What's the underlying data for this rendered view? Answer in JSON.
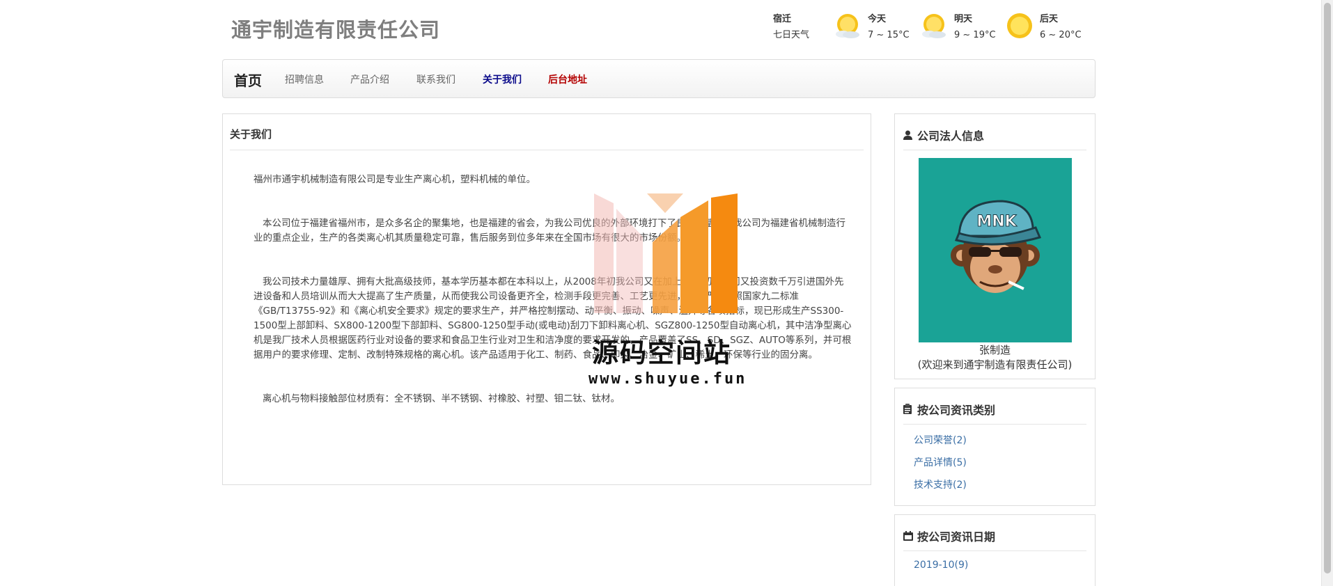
{
  "header": {
    "site_title": "通宇制造有限责任公司",
    "weather": {
      "city": "宿迁",
      "subtitle": "七日天气",
      "days": [
        {
          "name": "今天",
          "temp": "7 ~ 15°C",
          "icon": "sun-cloud-icon"
        },
        {
          "name": "明天",
          "temp": "9 ~ 19°C",
          "icon": "sun-cloud-icon"
        },
        {
          "name": "后天",
          "temp": "6 ~ 20°C",
          "icon": "sun-icon"
        }
      ]
    }
  },
  "nav": {
    "brand": "首页",
    "items": [
      "招聘信息",
      "产品介绍",
      "联系我们",
      "关于我们",
      "后台地址"
    ],
    "active_color": "#0a0a8a",
    "admin_color": "#b30000"
  },
  "main": {
    "title": "关于我们",
    "paragraphs": [
      "福州市通宇机械制造有限公司是专业生产离心机，塑料机械的单位。",
      "本公司位于福建省福州市，是众多名企的聚集地，也是福建的省会，为我公司优良的外部环境打下了良好的基础。我公司为福建省机械制造行业的重点企业，生产的各类离心机其质量稳定可靠，售后服务到位多年来在全国市场有很大的市场份额。",
      "我公司技术力量雄厚、拥有大批高级技师，基本学历基本都在本科以上，从2008年初我公司又在加上09年初我公司又投资数千万引进国外先进设备和人员培训从而大大提高了生产质量，从而使我公司设备更齐全，检测手段更完善、工艺更先进，产品严格按照国家九二标准《GB/T13755-92》和《离心机安全要求》规定的要求生产，并严格控制摆动、动平衡、振动、噪声、温升等各项指标，现已形成生产SS300-1500型上部卸料、SX800-1200型下部卸料、SG800-1250型手动(或电动)刮刀下卸料离心机、SGZ800-1250型自动离心机，其中洁净型离心机是我厂技术人员根据医药行业对设备的要求和食品卫生行业对卫生和洁净度的要求开发的，产品覆盖了SS、SD、SGZ、AUTO等系列，并可根据用户的要求修理、定制、改制特殊规格的离心机。该产品适用于化工、制药、食品、印染、冶金、矿山、稀土、环保等行业的固分离。",
      "离心机与物料接触部位材质有：全不锈钢、半不锈钢、衬橡胶、衬塑、钼二钛、钛材。"
    ]
  },
  "sidebar": {
    "legal": {
      "title": "公司法人信息",
      "icon": "user-icon",
      "avatar_bg": "#1aa396",
      "cap_text": "MNK",
      "name": "张制造",
      "welcome": "(欢迎来到通宇制造有限责任公司)"
    },
    "categories": {
      "title": "按公司资讯类别",
      "icon": "clipboard-icon",
      "items": [
        "公司荣誉(2)",
        "产品详情(5)",
        "技术支持(2)"
      ]
    },
    "dates": {
      "title": "按公司资讯日期",
      "icon": "calendar-icon",
      "items": [
        "2019-10(9)"
      ]
    }
  },
  "watermark": {
    "text": "源码空间站",
    "url": "www.shuyue.fun"
  }
}
